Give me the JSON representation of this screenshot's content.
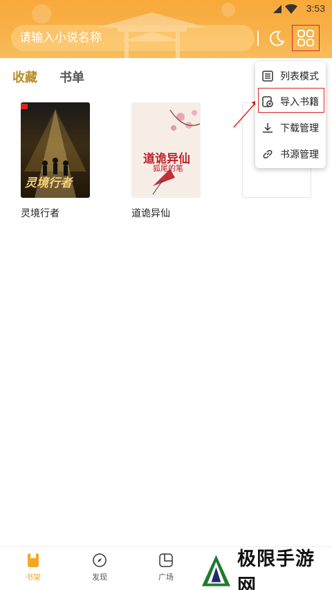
{
  "status": {
    "time": "3:53"
  },
  "search": {
    "placeholder": "请输入小说名称"
  },
  "tabs": [
    {
      "label": "收藏",
      "active": true
    },
    {
      "label": "书单",
      "active": false
    }
  ],
  "books": [
    {
      "title": "灵境行者",
      "cover_text": "灵境行者"
    },
    {
      "title": "道诡异仙",
      "cover_title": "道诡异仙",
      "cover_subtitle": "狐尾的笔"
    },
    {
      "title": ""
    }
  ],
  "menu": {
    "items": [
      {
        "label": "列表模式",
        "icon": "list-icon"
      },
      {
        "label": "导入书籍",
        "icon": "import-icon",
        "highlighted": true
      },
      {
        "label": "下载管理",
        "icon": "download-icon"
      },
      {
        "label": "书源管理",
        "icon": "link-icon"
      }
    ]
  },
  "nav": {
    "items": [
      {
        "label": "书架",
        "icon": "bookshelf-icon",
        "active": true
      },
      {
        "label": "发现",
        "icon": "compass-icon",
        "active": false
      },
      {
        "label": "广场",
        "icon": "square-icon",
        "active": false
      }
    ]
  },
  "watermark": {
    "text": "极限手游网"
  },
  "colors": {
    "header": "#f9a93a",
    "accent": "#f5a623",
    "tab_active": "#b78c2a",
    "highlight_border": "#dd2222"
  }
}
